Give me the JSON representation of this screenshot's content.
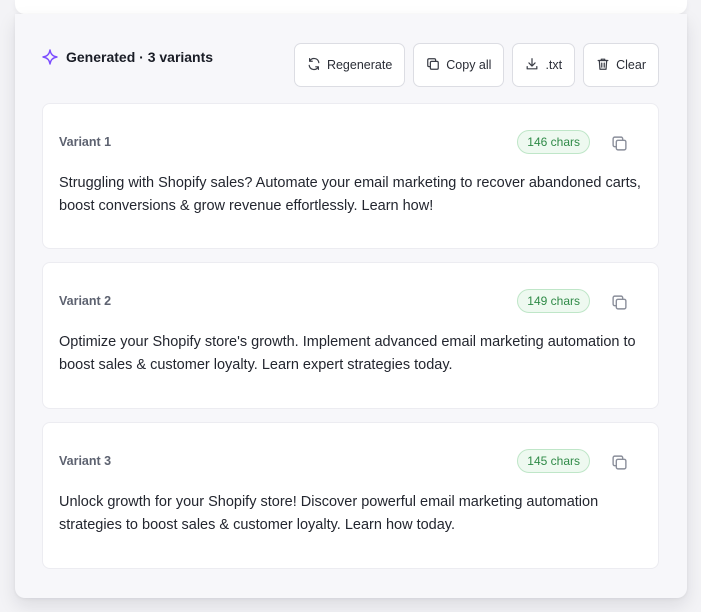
{
  "header": {
    "title": "Generated · 3 variants",
    "icon": "sparkle-icon"
  },
  "toolbar": {
    "regenerate_label": "Regenerate",
    "copy_all_label": "Copy all",
    "download_label": ".txt",
    "clear_label": "Clear"
  },
  "variants": [
    {
      "label": "Variant 1",
      "chars": "146 chars",
      "text": "Struggling with Shopify sales? Automate your email marketing to recover abandoned carts, boost conversions & grow revenue effortlessly. Learn how!"
    },
    {
      "label": "Variant 2",
      "chars": "149 chars",
      "text": "Optimize your Shopify store's growth. Implement advanced email marketing automation to boost sales & customer loyalty. Learn expert strategies today."
    },
    {
      "label": "Variant 3",
      "chars": "145 chars",
      "text": "Unlock growth for your Shopify store! Discover powerful email marketing automation strategies to boost sales & customer loyalty. Learn how today."
    }
  ],
  "colors": {
    "accent": "#7c4dff",
    "badge_bg": "#eef9f0",
    "badge_text": "#2f8a47"
  }
}
